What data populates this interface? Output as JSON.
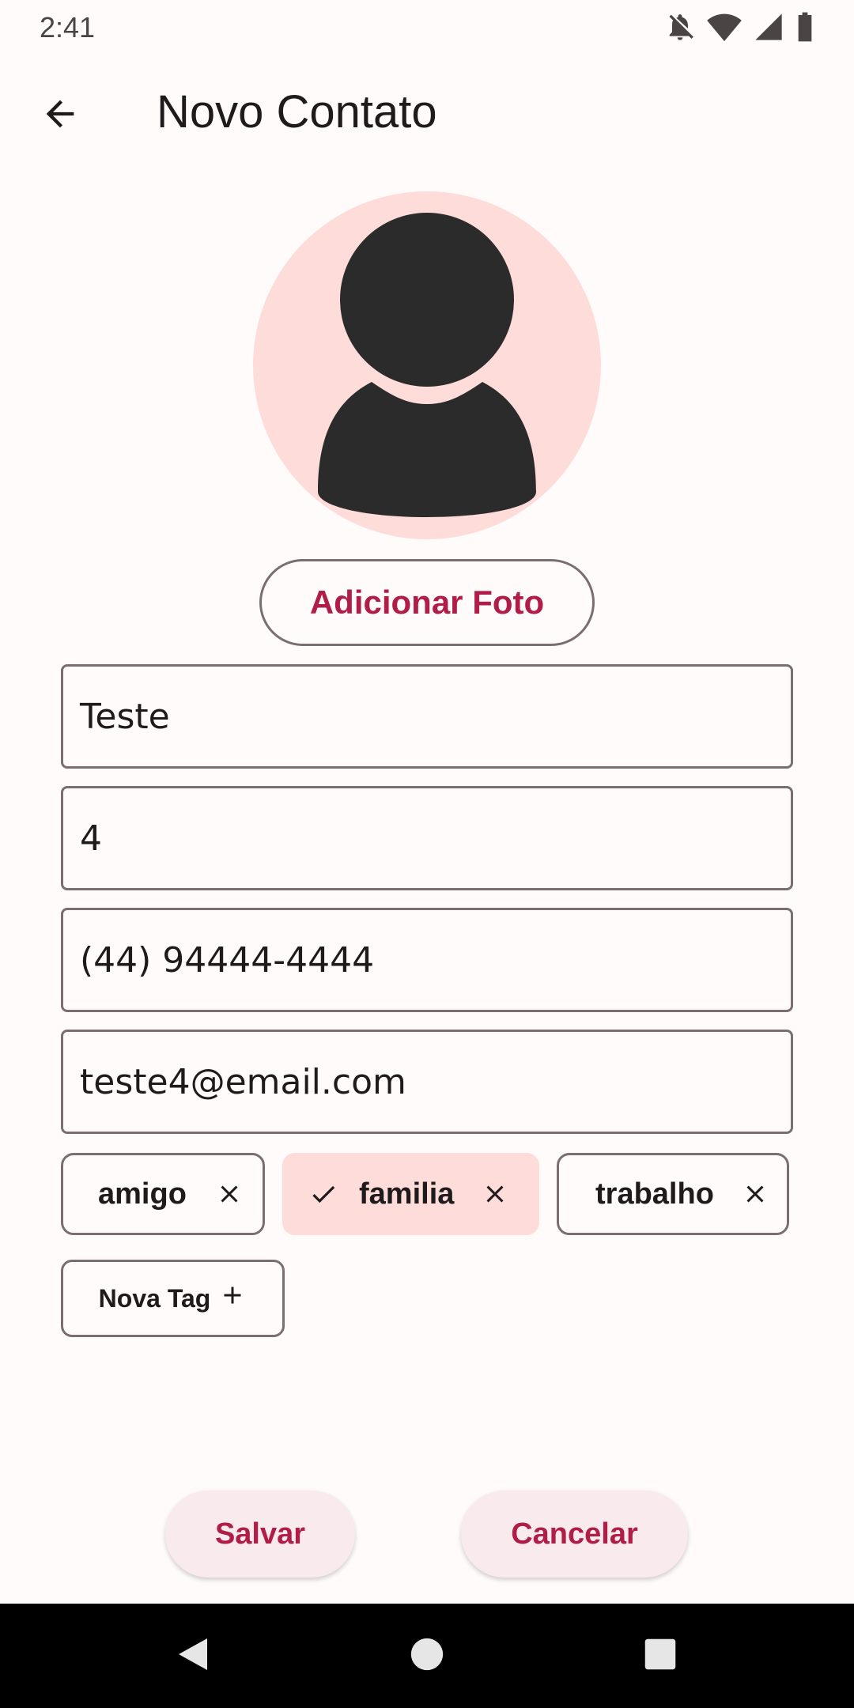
{
  "status_bar": {
    "time": "2:41",
    "icons": [
      "notifications-off-icon",
      "wifi-icon",
      "signal-icon",
      "battery-icon"
    ]
  },
  "app_bar": {
    "title": "Novo Contato",
    "back_icon": "arrow-back-icon"
  },
  "avatar": {
    "icon": "person-icon",
    "background": "#fddcd9"
  },
  "photo_button": {
    "label": "Adicionar Foto"
  },
  "fields": {
    "name": "Teste",
    "number": "4",
    "phone": "(44) 94444-4444",
    "email": "teste4@email.com"
  },
  "tags": [
    {
      "label": "amigo",
      "selected": false
    },
    {
      "label": "familia",
      "selected": true
    },
    {
      "label": "trabalho",
      "selected": false
    }
  ],
  "new_tag_button": {
    "label": "Nova Tag"
  },
  "actions": {
    "save_label": "Salvar",
    "cancel_label": "Cancelar"
  },
  "colors": {
    "accent": "#b01d47",
    "chip_selected": "#fddcd9",
    "outline": "#7a6e70",
    "background": "#fffbfb"
  }
}
